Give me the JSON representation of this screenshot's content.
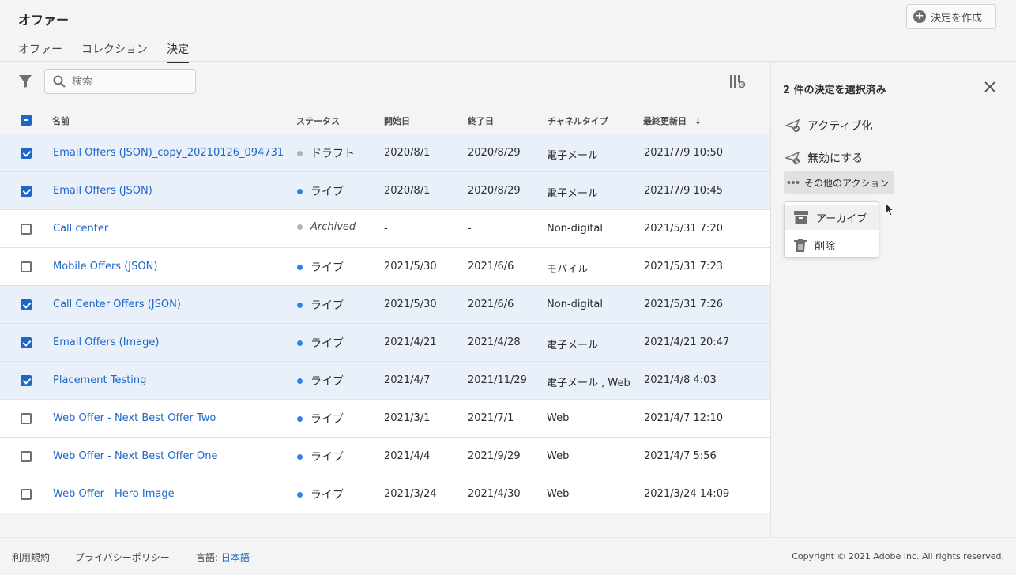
{
  "header": {
    "title": "オファー",
    "create_button": "決定を作成",
    "tabs": [
      {
        "label": "オファー",
        "active": false
      },
      {
        "label": "コレクション",
        "active": false
      },
      {
        "label": "決定",
        "active": true
      }
    ]
  },
  "toolbar": {
    "search_placeholder": "検索"
  },
  "table": {
    "columns": [
      "名前",
      "ステータス",
      "開始日",
      "終了日",
      "チャネルタイプ",
      "最終更新日"
    ],
    "sort_indicator": "↓",
    "rows": [
      {
        "selected": true,
        "name": "Email Offers (JSON)_copy_20210126_094731",
        "status": "ドラフト",
        "status_kind": "draft",
        "start": "2020/8/1",
        "end": "2020/8/29",
        "channel": "電子メール",
        "updated": "2021/7/9 10:50"
      },
      {
        "selected": true,
        "name": "Email Offers (JSON)",
        "status": "ライブ",
        "status_kind": "live",
        "start": "2020/8/1",
        "end": "2020/8/29",
        "channel": "電子メール",
        "updated": "2021/7/9 10:45"
      },
      {
        "selected": false,
        "name": "Call center",
        "status": "Archived",
        "status_kind": "archived",
        "start": "-",
        "end": "-",
        "channel": "Non-digital",
        "updated": "2021/5/31 7:20"
      },
      {
        "selected": false,
        "name": "Mobile Offers (JSON)",
        "status": "ライブ",
        "status_kind": "live",
        "start": "2021/5/30",
        "end": "2021/6/6",
        "channel": "モバイル",
        "updated": "2021/5/31 7:23"
      },
      {
        "selected": true,
        "name": "Call Center Offers (JSON)",
        "status": "ライブ",
        "status_kind": "live",
        "start": "2021/5/30",
        "end": "2021/6/6",
        "channel": "Non-digital",
        "updated": "2021/5/31 7:26"
      },
      {
        "selected": true,
        "name": "Email Offers (Image)",
        "status": "ライブ",
        "status_kind": "live",
        "start": "2021/4/21",
        "end": "2021/4/28",
        "channel": "電子メール",
        "updated": "2021/4/21 20:47"
      },
      {
        "selected": true,
        "name": "Placement Testing",
        "status": "ライブ",
        "status_kind": "live",
        "start": "2021/4/7",
        "end": "2021/11/29",
        "channel": "電子メール , Web",
        "updated": "2021/4/8 4:03"
      },
      {
        "selected": false,
        "name": "Web Offer - Next Best Offer Two",
        "status": "ライブ",
        "status_kind": "live",
        "start": "2021/3/1",
        "end": "2021/7/1",
        "channel": "Web",
        "updated": "2021/4/7 12:10"
      },
      {
        "selected": false,
        "name": "Web Offer - Next Best Offer One",
        "status": "ライブ",
        "status_kind": "live",
        "start": "2021/4/4",
        "end": "2021/9/29",
        "channel": "Web",
        "updated": "2021/4/7 5:56"
      },
      {
        "selected": false,
        "name": "Web Offer - Hero Image",
        "status": "ライブ",
        "status_kind": "live",
        "start": "2021/3/24",
        "end": "2021/4/30",
        "channel": "Web",
        "updated": "2021/3/24 14:09"
      }
    ]
  },
  "panel": {
    "title": "2 件の決定を選択済み",
    "actions": [
      "アクティブ化",
      "無効にする"
    ],
    "more_actions": "その他のアクション",
    "menu": [
      "アーカイブ",
      "削除"
    ]
  },
  "footer": {
    "terms": "利用規約",
    "privacy": "プライバシーポリシー",
    "language_label": "言語:",
    "language_value": "日本語",
    "copyright": "Copyright ©  2021 Adobe Inc.  All rights reserved."
  },
  "colors": {
    "accent": "#1e67c9",
    "live_dot": "#2f80ed",
    "draft_dot": "#b3b3b3",
    "selected_row": "#e9f0f9"
  }
}
